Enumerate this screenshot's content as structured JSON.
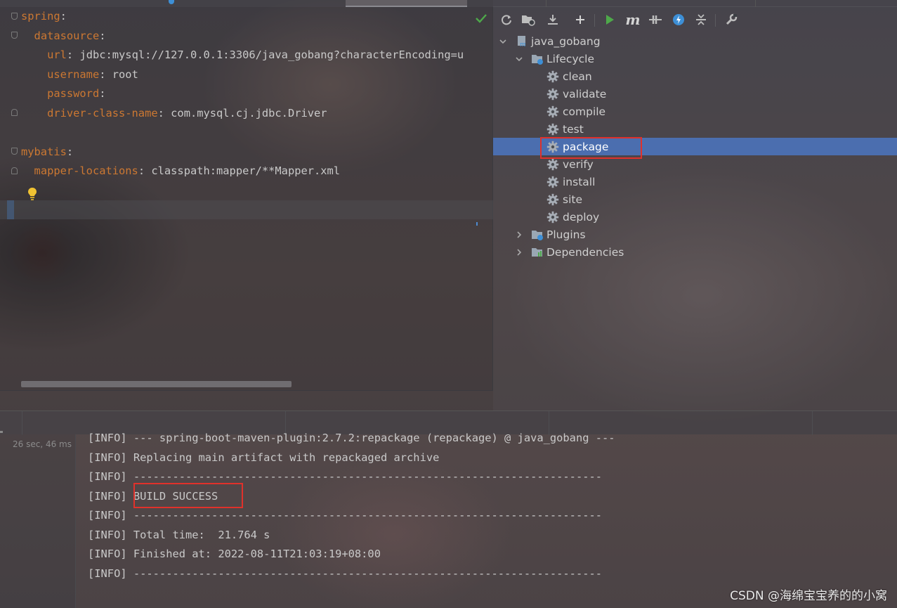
{
  "editor": {
    "lines": [
      {
        "indent": "",
        "key": "spring",
        "sep": ":",
        "value": ""
      },
      {
        "indent": "  ",
        "key": "datasource",
        "sep": ":",
        "value": ""
      },
      {
        "indent": "    ",
        "key": "url",
        "sep": ": ",
        "value": "jdbc:mysql://127.0.0.1:3306/java_gobang?characterEncoding=u"
      },
      {
        "indent": "    ",
        "key": "username",
        "sep": ": ",
        "value": "root"
      },
      {
        "indent": "    ",
        "key": "password",
        "sep": ":",
        "value": ""
      },
      {
        "indent": "    ",
        "key": "driver-class-name",
        "sep": ": ",
        "value": "com.mysql.cj.jdbc.Driver"
      },
      {
        "indent": "",
        "key": "",
        "sep": "",
        "value": ""
      },
      {
        "indent": "",
        "key": "mybatis",
        "sep": ":",
        "value": ""
      },
      {
        "indent": "  ",
        "key": "mapper-locations",
        "sep": ": ",
        "value": "classpath:mapper/**Mapper.xml"
      }
    ],
    "icons": {
      "inspection": "check-icon",
      "intention": "lightbulb-icon"
    }
  },
  "maven": {
    "toolbar": [
      "reload-icon",
      "generate-sources-icon",
      "download-icon",
      "add-icon",
      "run-icon",
      "maven-goal-icon",
      "toggle-offline-icon",
      "skip-tests-icon",
      "collapse-all-icon",
      "settings-wrench-icon"
    ],
    "project": "java_gobang",
    "lifecycle": {
      "label": "Lifecycle",
      "goals": [
        "clean",
        "validate",
        "compile",
        "test",
        "package",
        "verify",
        "install",
        "site",
        "deploy"
      ],
      "selected": "package"
    },
    "plugins_label": "Plugins",
    "dependencies_label": "Dependencies"
  },
  "run": {
    "elapsed": "26 sec, 46 ms",
    "lines": [
      "[INFO] --- spring-boot-maven-plugin:2.7.2:repackage (repackage) @ java_gobang ---",
      "[INFO] Replacing main artifact with repackaged archive",
      "[INFO] ------------------------------------------------------------------------",
      "[INFO] BUILD SUCCESS",
      "[INFO] ------------------------------------------------------------------------",
      "[INFO] Total time:  21.764 s",
      "[INFO] Finished at: 2022-08-11T21:03:19+08:00",
      "[INFO] ------------------------------------------------------------------------"
    ]
  },
  "watermark": "CSDN @海绵宝宝养的的小窝",
  "colors": {
    "key": "#cc7832",
    "selection": "#4b6eaf",
    "highlight_box": "#e0312b",
    "run_green": "#4ea94a"
  }
}
